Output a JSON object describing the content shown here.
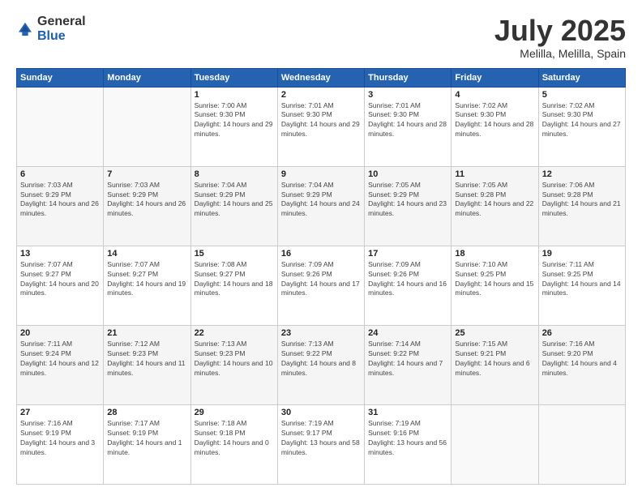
{
  "header": {
    "logo": {
      "general": "General",
      "blue": "Blue"
    },
    "title": "July 2025",
    "location": "Melilla, Melilla, Spain"
  },
  "weekdays": [
    "Sunday",
    "Monday",
    "Tuesday",
    "Wednesday",
    "Thursday",
    "Friday",
    "Saturday"
  ],
  "weeks": [
    [
      {
        "day": "",
        "sunrise": "",
        "sunset": "",
        "daylight": ""
      },
      {
        "day": "",
        "sunrise": "",
        "sunset": "",
        "daylight": ""
      },
      {
        "day": "1",
        "sunrise": "Sunrise: 7:00 AM",
        "sunset": "Sunset: 9:30 PM",
        "daylight": "Daylight: 14 hours and 29 minutes."
      },
      {
        "day": "2",
        "sunrise": "Sunrise: 7:01 AM",
        "sunset": "Sunset: 9:30 PM",
        "daylight": "Daylight: 14 hours and 29 minutes."
      },
      {
        "day": "3",
        "sunrise": "Sunrise: 7:01 AM",
        "sunset": "Sunset: 9:30 PM",
        "daylight": "Daylight: 14 hours and 28 minutes."
      },
      {
        "day": "4",
        "sunrise": "Sunrise: 7:02 AM",
        "sunset": "Sunset: 9:30 PM",
        "daylight": "Daylight: 14 hours and 28 minutes."
      },
      {
        "day": "5",
        "sunrise": "Sunrise: 7:02 AM",
        "sunset": "Sunset: 9:30 PM",
        "daylight": "Daylight: 14 hours and 27 minutes."
      }
    ],
    [
      {
        "day": "6",
        "sunrise": "Sunrise: 7:03 AM",
        "sunset": "Sunset: 9:29 PM",
        "daylight": "Daylight: 14 hours and 26 minutes."
      },
      {
        "day": "7",
        "sunrise": "Sunrise: 7:03 AM",
        "sunset": "Sunset: 9:29 PM",
        "daylight": "Daylight: 14 hours and 26 minutes."
      },
      {
        "day": "8",
        "sunrise": "Sunrise: 7:04 AM",
        "sunset": "Sunset: 9:29 PM",
        "daylight": "Daylight: 14 hours and 25 minutes."
      },
      {
        "day": "9",
        "sunrise": "Sunrise: 7:04 AM",
        "sunset": "Sunset: 9:29 PM",
        "daylight": "Daylight: 14 hours and 24 minutes."
      },
      {
        "day": "10",
        "sunrise": "Sunrise: 7:05 AM",
        "sunset": "Sunset: 9:29 PM",
        "daylight": "Daylight: 14 hours and 23 minutes."
      },
      {
        "day": "11",
        "sunrise": "Sunrise: 7:05 AM",
        "sunset": "Sunset: 9:28 PM",
        "daylight": "Daylight: 14 hours and 22 minutes."
      },
      {
        "day": "12",
        "sunrise": "Sunrise: 7:06 AM",
        "sunset": "Sunset: 9:28 PM",
        "daylight": "Daylight: 14 hours and 21 minutes."
      }
    ],
    [
      {
        "day": "13",
        "sunrise": "Sunrise: 7:07 AM",
        "sunset": "Sunset: 9:27 PM",
        "daylight": "Daylight: 14 hours and 20 minutes."
      },
      {
        "day": "14",
        "sunrise": "Sunrise: 7:07 AM",
        "sunset": "Sunset: 9:27 PM",
        "daylight": "Daylight: 14 hours and 19 minutes."
      },
      {
        "day": "15",
        "sunrise": "Sunrise: 7:08 AM",
        "sunset": "Sunset: 9:27 PM",
        "daylight": "Daylight: 14 hours and 18 minutes."
      },
      {
        "day": "16",
        "sunrise": "Sunrise: 7:09 AM",
        "sunset": "Sunset: 9:26 PM",
        "daylight": "Daylight: 14 hours and 17 minutes."
      },
      {
        "day": "17",
        "sunrise": "Sunrise: 7:09 AM",
        "sunset": "Sunset: 9:26 PM",
        "daylight": "Daylight: 14 hours and 16 minutes."
      },
      {
        "day": "18",
        "sunrise": "Sunrise: 7:10 AM",
        "sunset": "Sunset: 9:25 PM",
        "daylight": "Daylight: 14 hours and 15 minutes."
      },
      {
        "day": "19",
        "sunrise": "Sunrise: 7:11 AM",
        "sunset": "Sunset: 9:25 PM",
        "daylight": "Daylight: 14 hours and 14 minutes."
      }
    ],
    [
      {
        "day": "20",
        "sunrise": "Sunrise: 7:11 AM",
        "sunset": "Sunset: 9:24 PM",
        "daylight": "Daylight: 14 hours and 12 minutes."
      },
      {
        "day": "21",
        "sunrise": "Sunrise: 7:12 AM",
        "sunset": "Sunset: 9:23 PM",
        "daylight": "Daylight: 14 hours and 11 minutes."
      },
      {
        "day": "22",
        "sunrise": "Sunrise: 7:13 AM",
        "sunset": "Sunset: 9:23 PM",
        "daylight": "Daylight: 14 hours and 10 minutes."
      },
      {
        "day": "23",
        "sunrise": "Sunrise: 7:13 AM",
        "sunset": "Sunset: 9:22 PM",
        "daylight": "Daylight: 14 hours and 8 minutes."
      },
      {
        "day": "24",
        "sunrise": "Sunrise: 7:14 AM",
        "sunset": "Sunset: 9:22 PM",
        "daylight": "Daylight: 14 hours and 7 minutes."
      },
      {
        "day": "25",
        "sunrise": "Sunrise: 7:15 AM",
        "sunset": "Sunset: 9:21 PM",
        "daylight": "Daylight: 14 hours and 6 minutes."
      },
      {
        "day": "26",
        "sunrise": "Sunrise: 7:16 AM",
        "sunset": "Sunset: 9:20 PM",
        "daylight": "Daylight: 14 hours and 4 minutes."
      }
    ],
    [
      {
        "day": "27",
        "sunrise": "Sunrise: 7:16 AM",
        "sunset": "Sunset: 9:19 PM",
        "daylight": "Daylight: 14 hours and 3 minutes."
      },
      {
        "day": "28",
        "sunrise": "Sunrise: 7:17 AM",
        "sunset": "Sunset: 9:19 PM",
        "daylight": "Daylight: 14 hours and 1 minute."
      },
      {
        "day": "29",
        "sunrise": "Sunrise: 7:18 AM",
        "sunset": "Sunset: 9:18 PM",
        "daylight": "Daylight: 14 hours and 0 minutes."
      },
      {
        "day": "30",
        "sunrise": "Sunrise: 7:19 AM",
        "sunset": "Sunset: 9:17 PM",
        "daylight": "Daylight: 13 hours and 58 minutes."
      },
      {
        "day": "31",
        "sunrise": "Sunrise: 7:19 AM",
        "sunset": "Sunset: 9:16 PM",
        "daylight": "Daylight: 13 hours and 56 minutes."
      },
      {
        "day": "",
        "sunrise": "",
        "sunset": "",
        "daylight": ""
      },
      {
        "day": "",
        "sunrise": "",
        "sunset": "",
        "daylight": ""
      }
    ]
  ]
}
